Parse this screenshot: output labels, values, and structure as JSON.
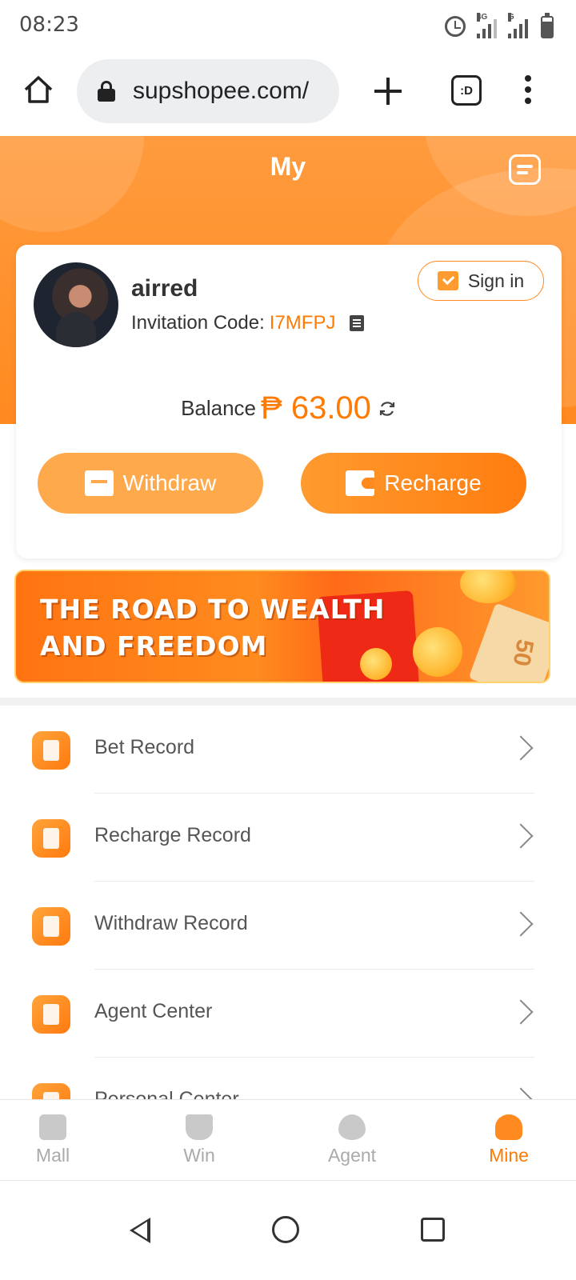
{
  "status_bar": {
    "time": "08:23",
    "network_1": "4G",
    "network_2": "G"
  },
  "browser": {
    "url": "supshopee.com/",
    "tabs_label": ":D"
  },
  "header": {
    "title": "My"
  },
  "profile": {
    "username": "airred",
    "invitation_label": "Invitation Code:",
    "invitation_code": "I7MFPJ",
    "sign_in_label": "Sign in",
    "balance_label": "Balance",
    "balance_value": "₱ 63.00"
  },
  "actions": {
    "withdraw_label": "Withdraw",
    "recharge_label": "Recharge"
  },
  "banner": {
    "line1": "THE ROAD TO WEALTH",
    "line2": "AND FREEDOM",
    "ticket_text": "50"
  },
  "menu": {
    "items": [
      {
        "label": "Bet Record",
        "icon": "bet-record-icon"
      },
      {
        "label": "Recharge Record",
        "icon": "recharge-record-icon"
      },
      {
        "label": "Withdraw Record",
        "icon": "withdraw-record-icon"
      },
      {
        "label": "Agent Center",
        "icon": "agent-center-icon"
      },
      {
        "label": "Personal Center",
        "icon": "personal-center-icon"
      }
    ]
  },
  "bottom_nav": {
    "items": [
      {
        "label": "Mall",
        "icon": "mall-icon"
      },
      {
        "label": "Win",
        "icon": "trophy-icon"
      },
      {
        "label": "Agent",
        "icon": "heart-handshake-icon"
      },
      {
        "label": "Mine",
        "icon": "person-icon"
      }
    ],
    "active": "Mine"
  },
  "colors": {
    "accent": "#ff7a00",
    "header_orange": "#ff8a1f",
    "muted_gray": "#aaaaaa"
  }
}
